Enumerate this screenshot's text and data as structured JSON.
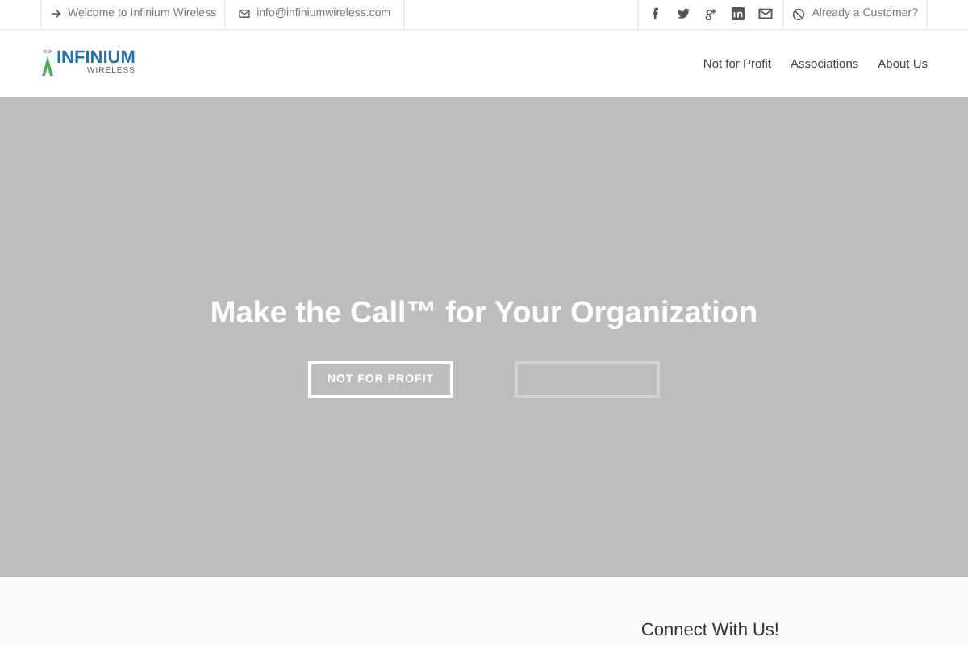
{
  "topbar": {
    "welcome": "Welcome to Infinium Wireless",
    "email": "info@infiniumwireless.com",
    "customer_link": "Already a Customer?"
  },
  "header": {
    "logo": {
      "name": "INFINIUM",
      "tagline": "WIRELESS"
    },
    "nav": [
      {
        "label": "Not for Profit"
      },
      {
        "label": "Associations"
      },
      {
        "label": "About Us"
      }
    ]
  },
  "hero": {
    "title": "Make the Call™ for Your Organization",
    "buttons": [
      {
        "label": "NOT FOR PROFIT",
        "kind": "outline"
      },
      {
        "kind": "faded"
      }
    ]
  },
  "footer": {
    "heading": "Connect With Us!"
  }
}
